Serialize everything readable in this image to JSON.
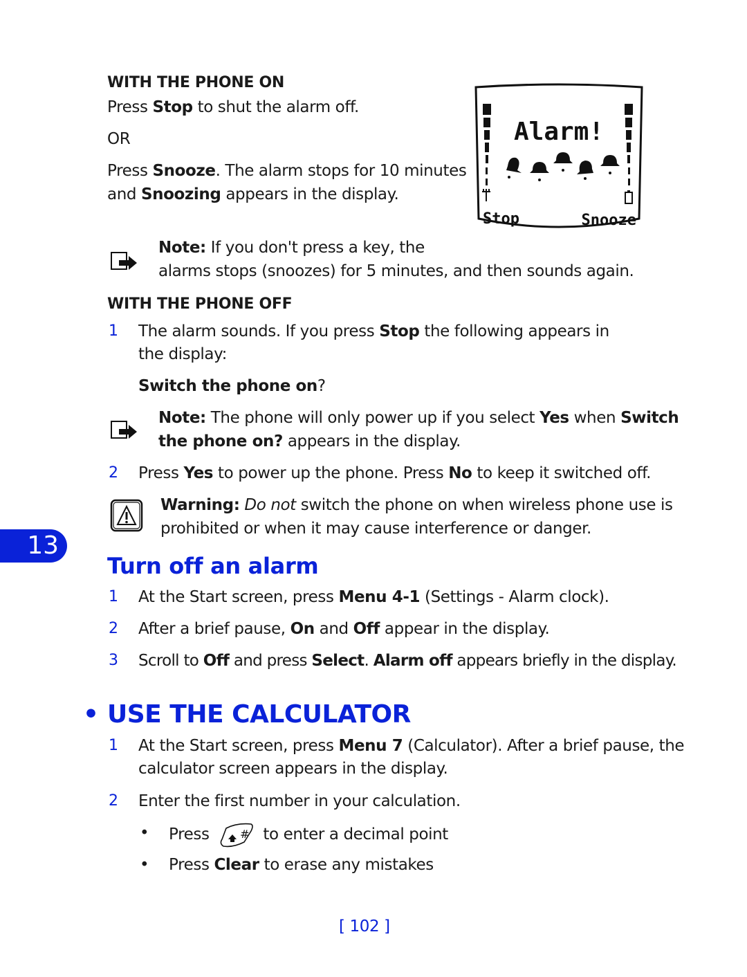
{
  "phone_on": {
    "heading": "WITH THE PHONE ON",
    "line1_pre": "Press ",
    "line1_bold": "Stop",
    "line1_post": " to shut the alarm off.",
    "or": "OR",
    "line2_pre": "Press ",
    "line2_bold": "Snooze",
    "line2_post": ". The alarm stops for 10 minutes",
    "line3_pre": "and ",
    "line3_bold": "Snoozing",
    "line3_post": " appears in the display."
  },
  "phone_screen": {
    "title": "Alarm!",
    "left_softkey": "Stop",
    "right_softkey": "Snooze"
  },
  "note1": {
    "label": "Note:",
    "line1": " If you don't press a key, the",
    "line2": "alarms stops (snoozes) for 5 minutes, and then sounds again."
  },
  "phone_off": {
    "heading": "WITH THE PHONE OFF",
    "step1": {
      "num": "1",
      "pre": "The alarm sounds. If you press ",
      "bold": "Stop",
      "post": " the following appears in",
      "line2": "the display:"
    },
    "display_text_bold": "Switch the phone on",
    "display_text_post": "?",
    "note2": {
      "label": "Note:",
      "pre": " The phone will only power up if you select ",
      "bold1": "Yes",
      "mid": " when ",
      "bold2": "Switch",
      "line2_bold": "the phone on?",
      "line2_post": " appears in the display."
    },
    "step2": {
      "num": "2",
      "pre": "Press ",
      "bold1": "Yes",
      "mid": " to power up the phone. Press ",
      "bold2": "No",
      "post": " to keep it switched off."
    },
    "warning": {
      "label": "Warning:",
      "italic": " Do not",
      "line1_post": " switch the phone on when wireless phone use is",
      "line2": "prohibited or when it may cause interference or danger."
    }
  },
  "chapter_tab": "13",
  "turn_off": {
    "heading": "Turn off an alarm",
    "steps": [
      {
        "num": "1",
        "pre": "At the Start screen, press ",
        "bold1": "Menu 4-1",
        "post": " (Settings - Alarm clock)."
      },
      {
        "num": "2",
        "pre": "After a brief pause, ",
        "bold1": "On",
        "mid": " and ",
        "bold2": "Off",
        "post": " appear in the display."
      },
      {
        "num": "3",
        "pre": "Scroll to ",
        "bold1": "Off",
        "mid": " and press ",
        "bold2": "Select",
        "mid2": ". ",
        "bold3": "Alarm off",
        "post": " appears briefly in the display."
      }
    ]
  },
  "calculator": {
    "bullet": "•",
    "heading": "USE THE CALCULATOR",
    "step1": {
      "num": "1",
      "pre": "At the Start screen, press ",
      "bold": "Menu 7",
      "post": " (Calculator). After a brief pause, the",
      "line2": "calculator screen appears in the display."
    },
    "step2": {
      "num": "2",
      "text": "Enter the first number in your calculation."
    },
    "bullets": [
      {
        "dot": "•",
        "pre": "Press",
        "key_icon": "hash-shift-key-icon",
        "post": "to enter a decimal point"
      },
      {
        "dot": "•",
        "pre": "Press ",
        "bold": "Clear",
        "post": " to erase any mistakes"
      }
    ]
  },
  "page_number": "[ 102 ]"
}
